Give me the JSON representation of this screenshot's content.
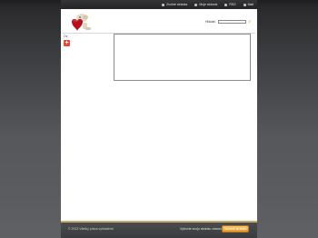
{
  "header": {
    "links": [
      {
        "icon": "star-icon",
        "label": "Zvoľné stránka"
      },
      {
        "icon": "user-icon",
        "label": "Moje stránok"
      },
      {
        "icon": "rss-icon",
        "label": "RSS"
      },
      {
        "icon": "mail-icon",
        "label": "Mail"
      }
    ]
  },
  "search": {
    "label": "Hľadať:",
    "placeholder": "",
    "button_icon": "magnifier-icon"
  },
  "sidebar": {
    "title": "Ov",
    "widget_icon": "plus-icon"
  },
  "footer": {
    "copyright": "© 2013 Všetky práva vyhradené",
    "cta_text": "Vytvorte svoju stránku zdarma",
    "cta_button": "Vytvoriť stránku"
  },
  "colors": {
    "accent": "#e29a2a",
    "footer_stripe": "#c9ad6a",
    "widget_red": "#e0483c"
  }
}
